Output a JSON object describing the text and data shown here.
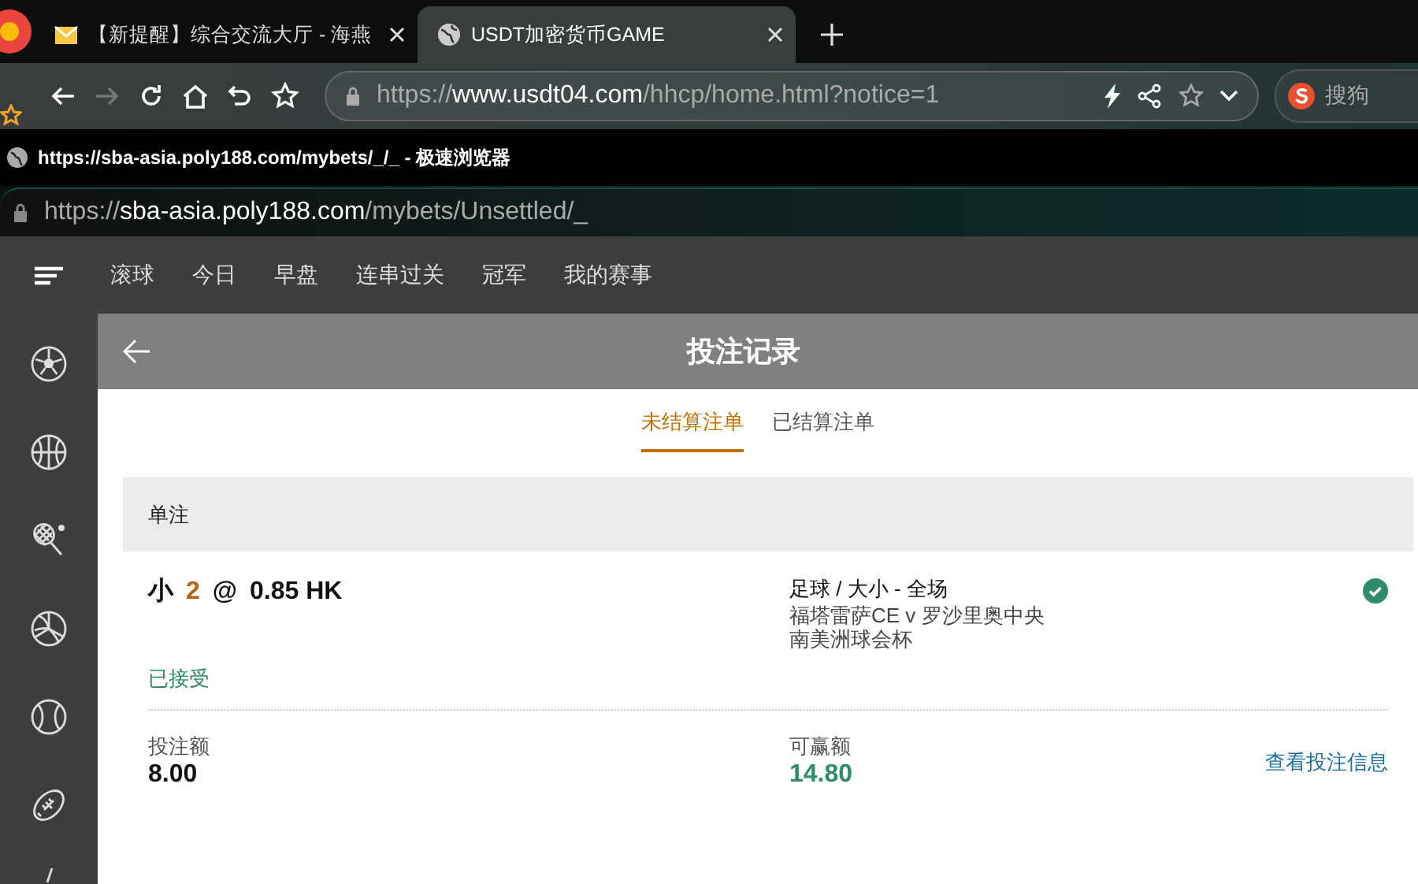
{
  "browser": {
    "tabs": [
      {
        "title": "【新提醒】综合交流大厅 - 海燕",
        "selected": false,
        "kind": "mail"
      },
      {
        "title": "USDT加密货币GAME",
        "selected": true,
        "kind": "site"
      }
    ],
    "address": {
      "scheme": "https://",
      "host": "www.usdt04.com",
      "path": "/hhcp/home.html?notice=1"
    },
    "search": {
      "label": "搜狗"
    },
    "tooltip": "https://sba-asia.poly188.com/mybets/_/_ - 极速浏览器",
    "popup_address": {
      "scheme": "https://",
      "host": "sba-asia.poly188.com",
      "path": "/mybets/Unsettled/_"
    }
  },
  "nav": {
    "items": [
      "滚球",
      "今日",
      "早盘",
      "连串过关",
      "冠军",
      "我的赛事"
    ]
  },
  "sidebar": {
    "items": [
      {
        "kind": "soccer"
      },
      {
        "kind": "basketball"
      },
      {
        "kind": "tennis"
      },
      {
        "kind": "volleyball"
      },
      {
        "kind": "baseball"
      },
      {
        "kind": "football"
      },
      {
        "kind": "partial"
      }
    ]
  },
  "header": {
    "title": "投注记录"
  },
  "tabs": [
    {
      "label": "未结算注单",
      "selected": true
    },
    {
      "label": "已结算注单",
      "selected": false
    }
  ],
  "section": {
    "title": "单注"
  },
  "bet": {
    "selection": "小",
    "line": "2",
    "at": "@",
    "odds": "0.85 HK",
    "market": "足球 / 大小 - 全场",
    "match": "福塔雷萨CE v 罗沙里奥中央",
    "league": "南美洲球会杯",
    "accepted": true,
    "status": "已接受",
    "stake_label": "投注额",
    "stake": "8.00",
    "win_label": "可赢额",
    "win": "14.80",
    "link": "查看投注信息"
  }
}
